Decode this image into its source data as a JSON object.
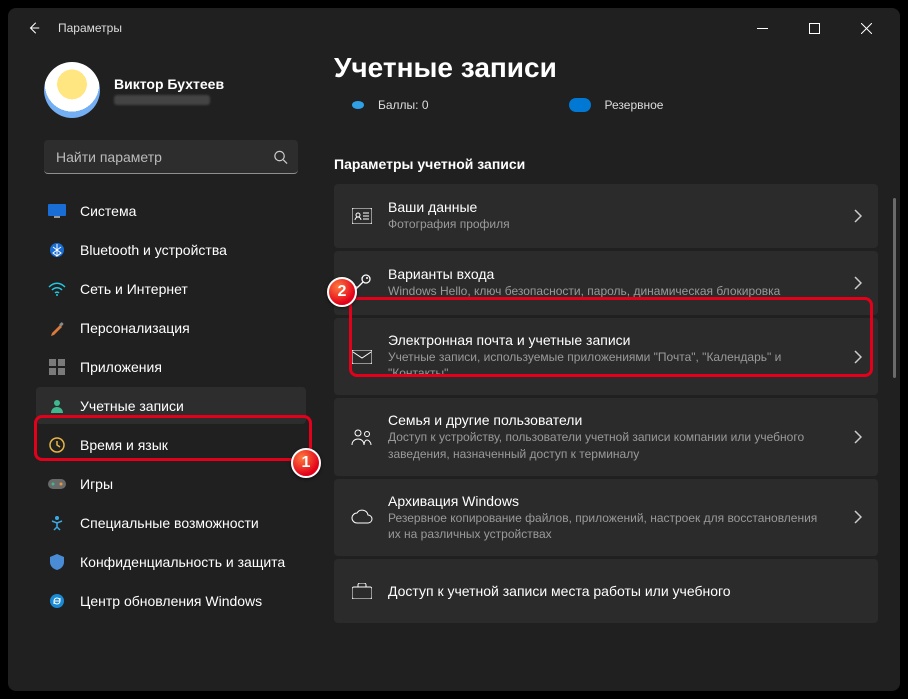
{
  "window": {
    "title": "Параметры"
  },
  "user": {
    "name": "Виктор Бухтеев"
  },
  "search": {
    "placeholder": "Найти параметр"
  },
  "nav": {
    "system": "Система",
    "bluetooth": "Bluetooth и устройства",
    "network": "Сеть и Интернет",
    "personalization": "Персонализация",
    "apps": "Приложения",
    "accounts": "Учетные записи",
    "time": "Время и язык",
    "games": "Игры",
    "accessibility": "Специальные возможности",
    "privacy": "Конфиденциальность и защита",
    "update": "Центр обновления Windows"
  },
  "page": {
    "title": "Учетные записи",
    "points_label": "Баллы: 0",
    "backup_label": "Резервное",
    "section_header": "Параметры учетной записи"
  },
  "cards": {
    "info": {
      "title": "Ваши данные",
      "sub": "Фотография профиля"
    },
    "signin": {
      "title": "Варианты входа",
      "sub": "Windows Hello, ключ безопасности, пароль, динамическая блокировка"
    },
    "email": {
      "title": "Электронная почта и учетные записи",
      "sub": "Учетные записи, используемые приложениями \"Почта\", \"Календарь\" и \"Контакты\""
    },
    "family": {
      "title": "Семья и другие пользователи",
      "sub": "Доступ к устройству, пользователи учетной записи компании или учебного заведения, назначенный доступ к терминалу"
    },
    "backup": {
      "title": "Архивация Windows",
      "sub": "Резервное копирование файлов, приложений, настроек для восстановления их на различных устройствах"
    },
    "work": {
      "title": "Доступ к учетной записи места работы или учебного"
    }
  },
  "annotations": {
    "one": "1",
    "two": "2"
  }
}
